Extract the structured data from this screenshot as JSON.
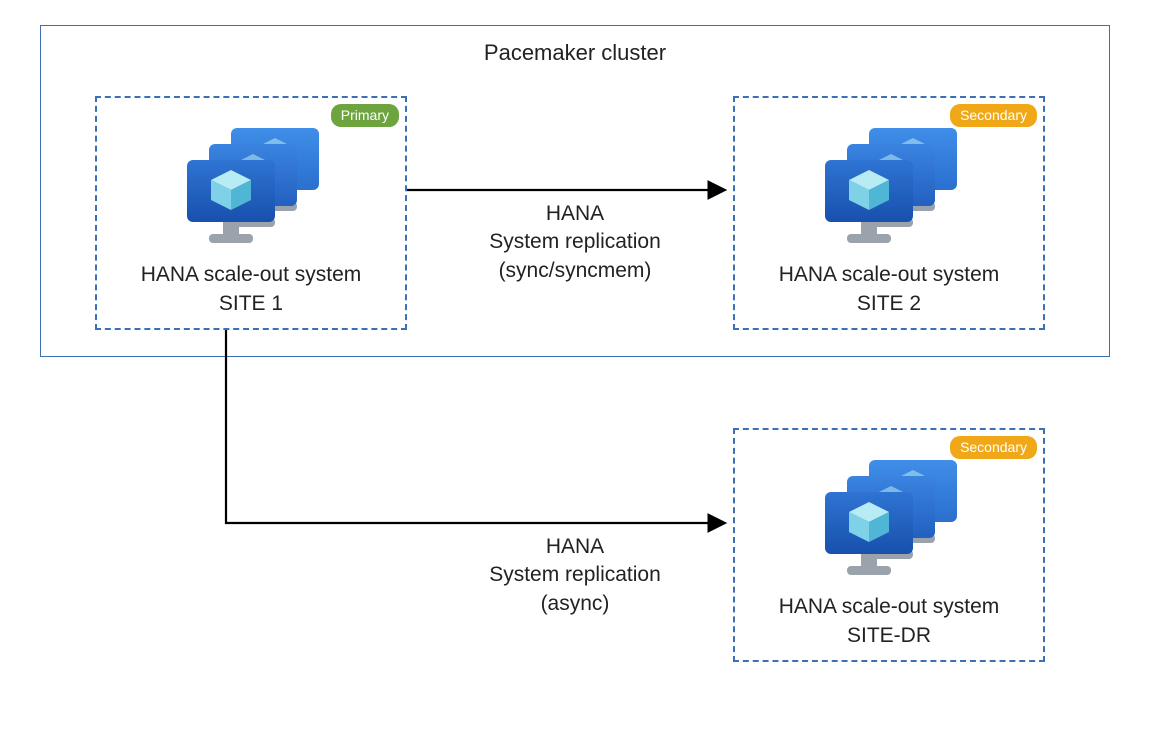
{
  "cluster": {
    "title": "Pacemaker cluster"
  },
  "sites": {
    "site1": {
      "badge": "Primary",
      "label_line1": "HANA scale-out system",
      "label_line2": "SITE 1"
    },
    "site2": {
      "badge": "Secondary",
      "label_line1": "HANA scale-out system",
      "label_line2": "SITE 2"
    },
    "sitedr": {
      "badge": "Secondary",
      "label_line1": "HANA scale-out system",
      "label_line2": "SITE-DR"
    }
  },
  "arrows": {
    "sync": {
      "line1": "HANA",
      "line2": "System replication",
      "line3": "(sync/syncmem)"
    },
    "async": {
      "line1": "HANA",
      "line2": "System replication",
      "line3": "(async)"
    }
  }
}
